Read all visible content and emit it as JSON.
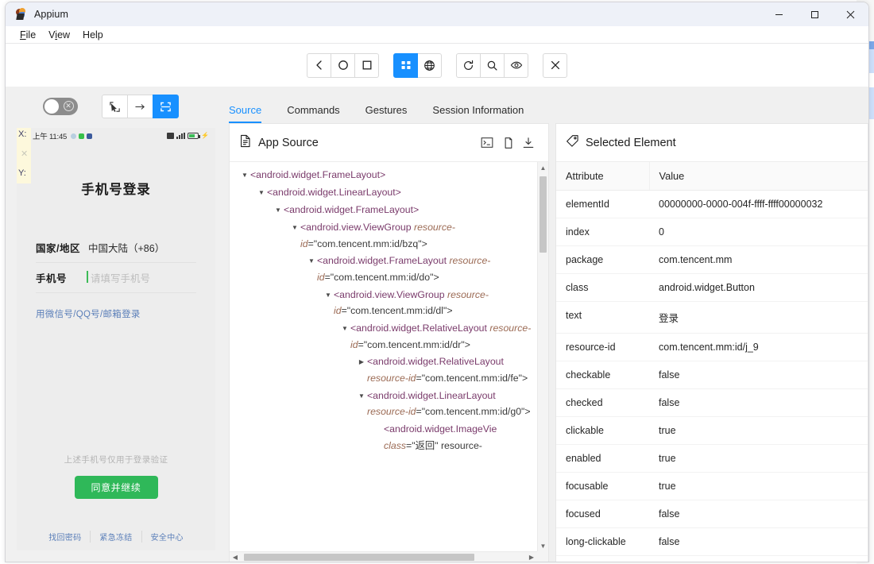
{
  "window": {
    "title": "Appium",
    "logo_icon": "appium-logo-icon",
    "minimize_label": "—",
    "maximize_label": "□",
    "close_label": "✕"
  },
  "menubar": {
    "items": [
      {
        "label": "File",
        "mnemonic": "F"
      },
      {
        "label": "View",
        "mnemonic": "V"
      },
      {
        "label": "Help",
        "mnemonic": "H"
      }
    ]
  },
  "device_toolbar": {
    "groups": [
      {
        "buttons": [
          {
            "name": "back-button",
            "icon": "chevron-left-icon",
            "active": false
          },
          {
            "name": "home-button",
            "icon": "circle-icon",
            "active": false
          },
          {
            "name": "recent-apps-button",
            "icon": "square-icon",
            "active": false
          }
        ]
      },
      {
        "buttons": [
          {
            "name": "app-grid-button",
            "icon": "app-grid-icon",
            "active": true
          },
          {
            "name": "globe-button",
            "icon": "globe-icon",
            "active": false
          }
        ]
      },
      {
        "buttons": [
          {
            "name": "refresh-source-button",
            "icon": "refresh-icon",
            "active": false
          },
          {
            "name": "search-element-button",
            "icon": "search-icon",
            "active": false
          },
          {
            "name": "eye-button",
            "icon": "eye-icon",
            "active": false
          }
        ]
      },
      {
        "buttons": [
          {
            "name": "quit-session-button",
            "icon": "close-x-icon",
            "active": false
          }
        ]
      }
    ]
  },
  "left_panel": {
    "recording_toggle": {
      "name": "recording-toggle",
      "state": "off",
      "icon": "toggle-off-icon"
    },
    "mode_buttons": [
      {
        "name": "select-element-mode",
        "icon": "cursor-select-icon",
        "active": false
      },
      {
        "name": "swipe-mode",
        "icon": "arrow-right-icon",
        "active": false
      },
      {
        "name": "tap-crop-mode",
        "icon": "crop-scan-icon",
        "active": true
      }
    ],
    "coordinates": {
      "x_label": "X:",
      "y_label": "Y:",
      "x_value": "",
      "y_value": ""
    }
  },
  "device_screen": {
    "status_bar": {
      "time": "上午 11:45",
      "icons": [
        "app-dot-icon",
        "green-app-icon",
        "blue-app-icon"
      ],
      "right_icons": [
        "nfc-icon",
        "signal-bars-icon",
        "battery-charging-icon"
      ]
    },
    "title": "手机号登录",
    "fields": [
      {
        "label": "国家/地区",
        "value": "中国大陆（+86）",
        "is_placeholder": false
      },
      {
        "label": "手机号",
        "value": "请填写手机号",
        "is_placeholder": true
      }
    ],
    "alt_login_link": "用微信号/QQ号/邮箱登录",
    "note": "上述手机号仅用于登录验证",
    "cta_label": "同意并继续",
    "cta_color": "#2fb859",
    "footer_links": [
      "找回密码",
      "紧急冻结",
      "安全中心"
    ]
  },
  "tabs": [
    {
      "label": "Source",
      "active": true,
      "name": "tab-source"
    },
    {
      "label": "Commands",
      "active": false,
      "name": "tab-commands"
    },
    {
      "label": "Gestures",
      "active": false,
      "name": "tab-gestures"
    },
    {
      "label": "Session Information",
      "active": false,
      "name": "tab-session-information"
    }
  ],
  "source_panel": {
    "title": "App Source",
    "title_icon": "file-document-icon",
    "actions": [
      {
        "name": "open-console-button",
        "icon": "terminal-icon"
      },
      {
        "name": "copy-source-button",
        "icon": "copy-icon"
      },
      {
        "name": "download-source-button",
        "icon": "download-icon"
      }
    ],
    "tree": [
      {
        "indent": 0,
        "caret": "down",
        "tag": "<android.widget.FrameLayout>",
        "attr_key": "",
        "attr_val": ""
      },
      {
        "indent": 1,
        "caret": "down",
        "tag": "<android.widget.LinearLayout>",
        "attr_key": "",
        "attr_val": ""
      },
      {
        "indent": 2,
        "caret": "down",
        "tag": "<android.widget.FrameLayout>",
        "attr_key": "",
        "attr_val": ""
      },
      {
        "indent": 3,
        "caret": "down",
        "tag": "<android.view.ViewGroup",
        "attr_key": "resource-id",
        "attr_val": "=\"com.tencent.mm:id/bzq\">"
      },
      {
        "indent": 4,
        "caret": "down",
        "tag": "<android.widget.FrameLayout",
        "attr_key": "resource-id",
        "attr_val": "=\"com.tencent.mm:id/do\">"
      },
      {
        "indent": 5,
        "caret": "down",
        "tag": "<android.view.ViewGroup",
        "attr_key": "resource-id",
        "attr_val": "=\"com.tencent.mm:id/dl\">"
      },
      {
        "indent": 6,
        "caret": "down",
        "tag": "<android.widget.RelativeLayout",
        "attr_key": "resource-id",
        "attr_val": "=\"com.tencent.mm:id/dr\">"
      },
      {
        "indent": 7,
        "caret": "right",
        "tag": "<android.widget.RelativeLayout",
        "attr_key": "resource-id",
        "attr_val": "=\"com.tencent.mm:id/fe\">"
      },
      {
        "indent": 7,
        "caret": "down",
        "tag": "<android.widget.LinearLayout",
        "attr_key": "resource-id",
        "attr_val": "=\"com.tencent.mm:id/g0\">"
      },
      {
        "indent": 8,
        "caret": "none",
        "tag": "<android.widget.ImageVie",
        "attr_key": "class",
        "attr_val": "=\"返回\" resource-"
      }
    ],
    "scroll": {
      "vertical": "near-top",
      "horizontal": "left"
    }
  },
  "element_panel": {
    "title": "Selected Element",
    "title_icon": "tag-icon",
    "columns": [
      "Attribute",
      "Value"
    ],
    "rows": [
      {
        "attribute": "elementId",
        "value": "00000000-0000-004f-ffff-ffff00000032"
      },
      {
        "attribute": "index",
        "value": "0"
      },
      {
        "attribute": "package",
        "value": "com.tencent.mm"
      },
      {
        "attribute": "class",
        "value": "android.widget.Button"
      },
      {
        "attribute": "text",
        "value": "登录"
      },
      {
        "attribute": "resource-id",
        "value": "com.tencent.mm:id/j_9"
      },
      {
        "attribute": "checkable",
        "value": "false"
      },
      {
        "attribute": "checked",
        "value": "false"
      },
      {
        "attribute": "clickable",
        "value": "true"
      },
      {
        "attribute": "enabled",
        "value": "true"
      },
      {
        "attribute": "focusable",
        "value": "true"
      },
      {
        "attribute": "focused",
        "value": "false"
      },
      {
        "attribute": "long-clickable",
        "value": "false"
      }
    ]
  },
  "colors": {
    "accent": "#1890ff",
    "wechat_green": "#2fb859",
    "tag_purple": "#7a3b6b",
    "attr_brown": "#9b6a54"
  }
}
